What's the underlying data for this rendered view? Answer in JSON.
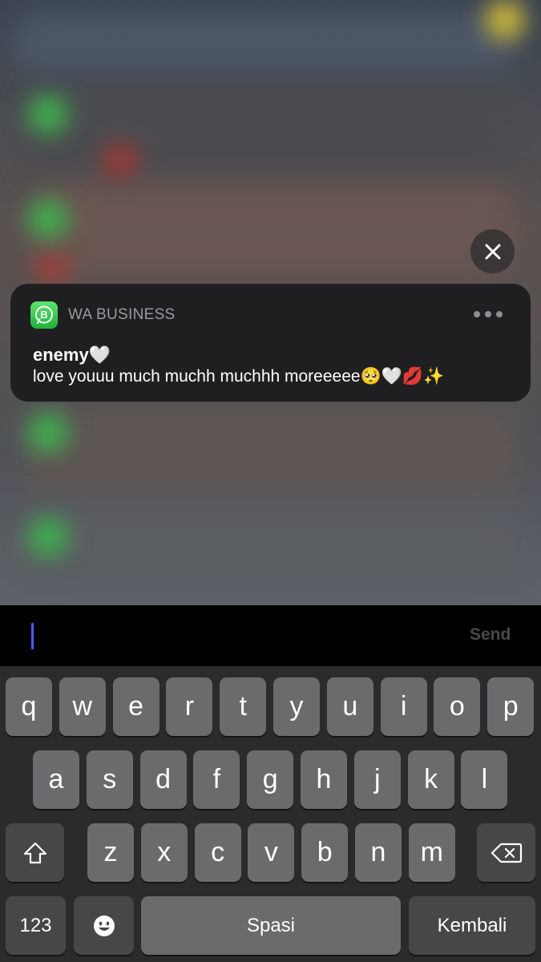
{
  "notification": {
    "app_name": "WA BUSINESS",
    "sender": "enemy🤍",
    "message": "love youuu much muchh muchhh moreeeee🥺🤍💋✨"
  },
  "reply": {
    "placeholder": "",
    "send_label": "Send"
  },
  "keyboard": {
    "row1": [
      "q",
      "w",
      "e",
      "r",
      "t",
      "y",
      "u",
      "i",
      "o",
      "p"
    ],
    "row2": [
      "a",
      "s",
      "d",
      "f",
      "g",
      "h",
      "j",
      "k",
      "l"
    ],
    "row3": [
      "z",
      "x",
      "c",
      "v",
      "b",
      "n",
      "m"
    ],
    "numbers_label": "123",
    "space_label": "Spasi",
    "return_label": "Kembali",
    "shift_icon": "shift-icon",
    "backspace_icon": "backspace-icon",
    "emoji_icon": "emoji-icon"
  },
  "colors": {
    "app_icon_green": "#25d366",
    "caret": "#4a5cff",
    "card_bg": "#1f1f21"
  }
}
